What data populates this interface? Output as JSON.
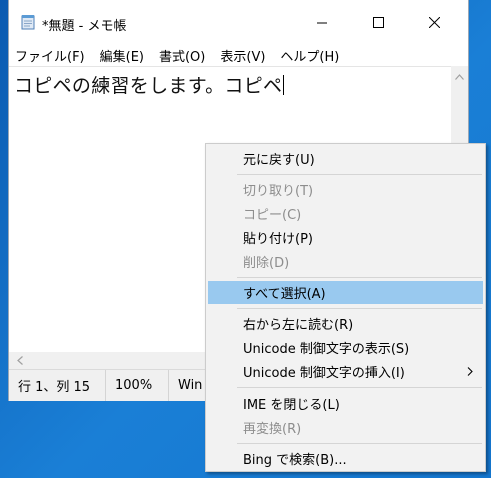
{
  "window": {
    "title": "*無題 - メモ帳",
    "app_icon": "notepad-icon",
    "caption_buttons": [
      "minimize-icon",
      "maximize-icon",
      "close-icon"
    ]
  },
  "menubar": {
    "items": [
      "ファイル(F)",
      "編集(E)",
      "書式(O)",
      "表示(V)",
      "ヘルプ(H)"
    ]
  },
  "editor": {
    "text": "コピペの練習をします。コピペ"
  },
  "statusbar": {
    "position": "行 1、列 15",
    "zoom": "100%",
    "line_ending_partial": "Win"
  },
  "context_menu": {
    "highlight_color": "#99c9ef",
    "items": [
      {
        "label": "元に戻す(U)",
        "enabled": true
      },
      {
        "label": "切り取り(T)",
        "enabled": false
      },
      {
        "label": "コピー(C)",
        "enabled": false
      },
      {
        "label": "貼り付け(P)",
        "enabled": true
      },
      {
        "label": "削除(D)",
        "enabled": false
      },
      {
        "label": "すべて選択(A)",
        "enabled": true,
        "highlighted": true
      },
      {
        "label": "右から左に読む(R)",
        "enabled": true
      },
      {
        "label": "Unicode 制御文字の表示(S)",
        "enabled": true
      },
      {
        "label": "Unicode 制御文字の挿入(I)",
        "enabled": true,
        "submenu": true
      },
      {
        "label": "IME を閉じる(L)",
        "enabled": true
      },
      {
        "label": "再変換(R)",
        "enabled": false
      },
      {
        "label": "Bing で検索(B)...",
        "enabled": true
      }
    ]
  }
}
